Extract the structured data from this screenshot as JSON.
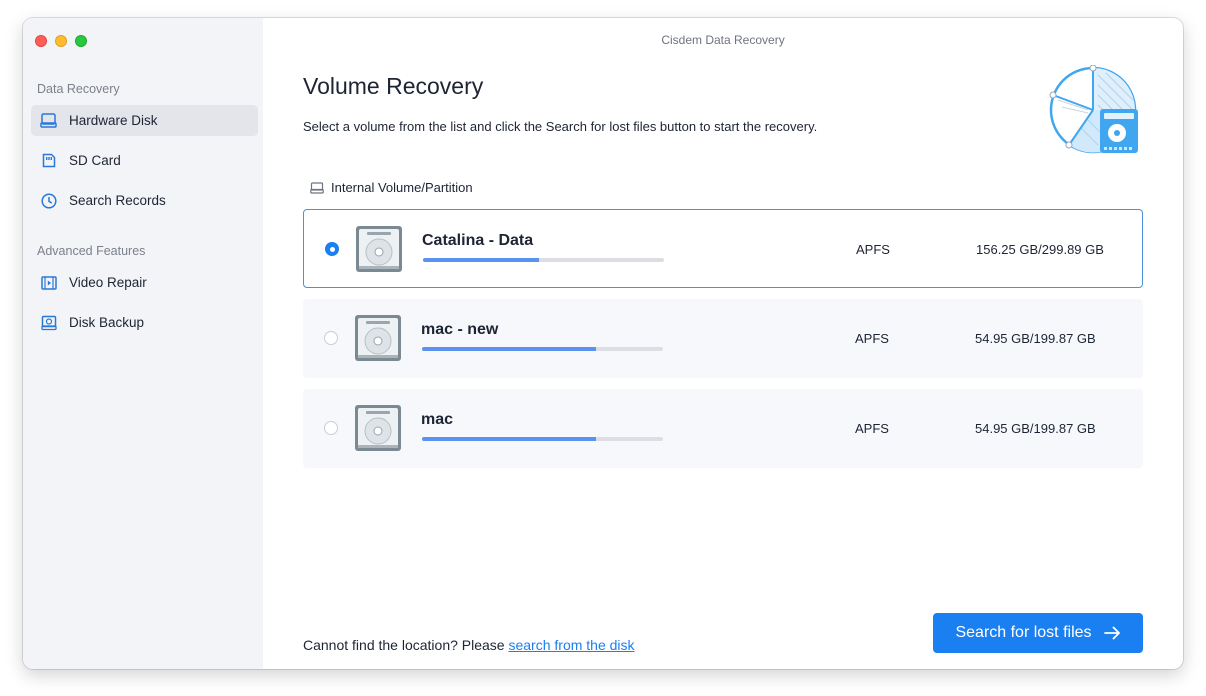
{
  "window": {
    "title": "Cisdem Data Recovery"
  },
  "sidebar": {
    "sections": [
      {
        "label": "Data Recovery",
        "items": [
          {
            "label": "Hardware Disk",
            "icon": "hard-disk-icon",
            "active": true
          },
          {
            "label": "SD Card",
            "icon": "sd-card-icon",
            "active": false
          },
          {
            "label": "Search Records",
            "icon": "clock-icon",
            "active": false
          }
        ]
      },
      {
        "label": "Advanced Features",
        "items": [
          {
            "label": "Video Repair",
            "icon": "film-icon",
            "active": false
          },
          {
            "label": "Disk Backup",
            "icon": "backup-icon",
            "active": false
          }
        ]
      }
    ]
  },
  "main": {
    "title": "Volume Recovery",
    "subtitle": "Select a volume from the list and click the Search for lost files button to start the recovery.",
    "group_label": "Internal Volume/Partition",
    "volumes": [
      {
        "name": "Catalina - Data",
        "fs": "APFS",
        "size": "156.25 GB/299.89 GB",
        "used_fraction": 0.48,
        "selected": true
      },
      {
        "name": "mac - new",
        "fs": "APFS",
        "size": "54.95 GB/199.87 GB",
        "used_fraction": 0.72,
        "selected": false
      },
      {
        "name": "mac",
        "fs": "APFS",
        "size": "54.95 GB/199.87 GB",
        "used_fraction": 0.72,
        "selected": false
      }
    ],
    "footer": {
      "prefix": "Cannot find the location? Please ",
      "link": "search from the disk"
    },
    "primary_button": "Search for lost files"
  },
  "colors": {
    "accent": "#1a7ff0",
    "sidebar_bg": "#f3f4f8",
    "bar_fill": "#5b92f0"
  }
}
